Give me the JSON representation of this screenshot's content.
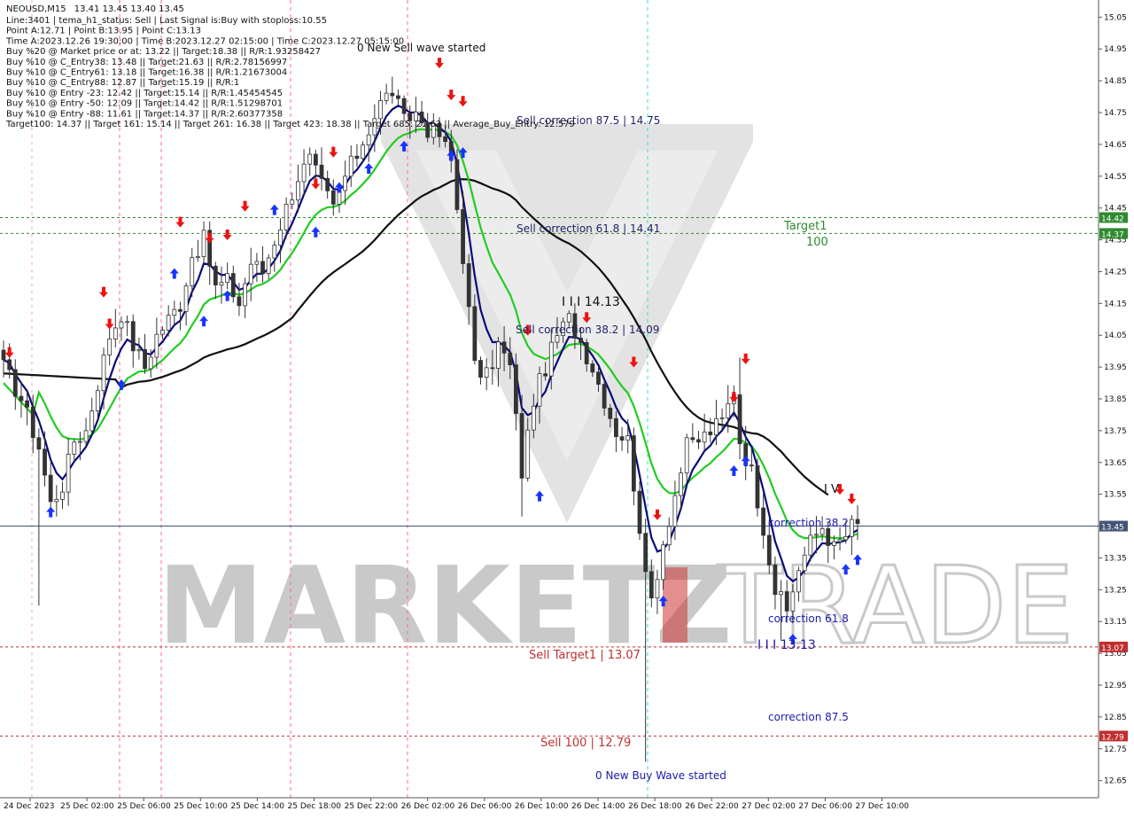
{
  "header": {
    "symbol": "NEOUSD,M15",
    "ohlc": "13.41 13.45 13.40 13.45",
    "lines": [
      "Line:3401 | tema_h1_status: Sell | Last Signal is:Buy with stoploss:10.55",
      "Point A:12.71 | Point B:13.95 | Point C:13.13",
      "Time A:2023.12.26 19:30:00 | Time B:2023.12.27 02:15:00 | Time C:2023.12.27 05:15:00",
      "Buy %20 @ Market price or at: 13.22 || Target:18.38 || R/R:1.93258427",
      "Buy %10 @ C_Entry38: 13.48 || Target:21.63 || R/R:2.78156997",
      "Buy %10 @ C_Entry61: 13.18 || Target:16.38 || R/R:1.21673004",
      "Buy %10 @ C_Entry88: 12.87 || Target:15.19 || R/R:1",
      "Buy %10 @ Entry -23: 12.42 || Target:15.14 || R/R:1.45454545",
      "Buy %10 @ Entry -50: 12.09 || Target:14.42 || R/R:1.51298701",
      "Buy %10 @ Entry -88: 11.61 || Target:14.37 || R/R:2.60377358",
      "Target100: 14.37 || Target 161: 15.14 || Target 261: 16.38 || Target 423: 18.38 || Target 685: 21.63 || Average_Buy_Entry: 12.579"
    ]
  },
  "colors": {
    "background": "#ffffff",
    "bull_candle": "#3a3a3a",
    "bear_candle": "#3a3a3a",
    "ma_fast": "#0a0a7a",
    "ma_mid": "#22cc22",
    "ma_slow": "#111111",
    "buy_arrow": "#1a33ff",
    "sell_arrow": "#ee1111",
    "target_green": "#2e8b2e",
    "sell_red": "#c03030",
    "watermark": "#c9c9c9",
    "watermark_accent": "#cc3333",
    "grid_pink": "#ff66aa",
    "cyan_line": "#33dddd",
    "blue_text": "#1a1aaa"
  },
  "annotations": {
    "new_sell_wave": "0 New Sell wave started",
    "sell_corr_875": "Sell correction 87.5 | 14.75",
    "sell_corr_618": "Sell correction 61.8 | 14.41",
    "sell_corr_382": "Sell correction 38.2 | 14.09",
    "wave_label_1413": "I I I 14.13",
    "target1": "Target1",
    "target1_value": "100",
    "sell_target1": "Sell Target1 | 13.07",
    "sell_100": "Sell 100 | 12.79",
    "new_buy_wave": "0 New Buy Wave started",
    "correction_382": "correction 38.2",
    "correction_618": "correction 61.8",
    "correction_875": "correction 87.5",
    "wave_label_1313": "I I I 13.13",
    "wave_label_iv": "I V"
  },
  "watermark": {
    "left": "MARKETZ",
    "right": "TRADE"
  },
  "chart_data": {
    "type": "candlestick",
    "ylim": [
      12.61,
      15.09
    ],
    "y_ticks": [
      "15.05",
      "14.95",
      "14.85",
      "14.75",
      "14.65",
      "14.55",
      "14.45",
      "14.35",
      "14.25",
      "14.15",
      "14.05",
      "13.95",
      "13.85",
      "13.75",
      "13.65",
      "13.55",
      "13.45",
      "13.35",
      "13.25",
      "13.15",
      "13.05",
      "12.95",
      "12.85",
      "12.75",
      "12.65"
    ],
    "x_ticks": [
      "24 Dec 2023",
      "25 Dec 02:00",
      "25 Dec 06:00",
      "25 Dec 10:00",
      "25 Dec 14:00",
      "25 Dec 18:00",
      "25 Dec 22:00",
      "26 Dec 02:00",
      "26 Dec 06:00",
      "26 Dec 10:00",
      "26 Dec 14:00",
      "26 Dec 18:00",
      "26 Dec 22:00",
      "27 Dec 02:00",
      "27 Dec 06:00",
      "27 Dec 10:00"
    ],
    "horizontal_levels": [
      {
        "value": 14.42,
        "label": "14.42",
        "color": "#2e8b2e",
        "style": "dashed"
      },
      {
        "value": 14.37,
        "label": "14.37",
        "color": "#2e8b2e",
        "style": "dashed"
      },
      {
        "value": 13.45,
        "label": "13.45",
        "color": "#445577",
        "style": "solid"
      },
      {
        "value": 13.07,
        "label": "13.07",
        "color": "#c03030",
        "style": "dashed"
      },
      {
        "value": 12.79,
        "label": "12.79",
        "color": "#c03030",
        "style": "dashed"
      }
    ],
    "current_price": 13.45,
    "close_path": [
      [
        0,
        13.95
      ],
      [
        3,
        13.85
      ],
      [
        6,
        13.7
      ],
      [
        8,
        13.52
      ],
      [
        10,
        13.58
      ],
      [
        12,
        13.72
      ],
      [
        14,
        13.75
      ],
      [
        16,
        13.9
      ],
      [
        18,
        14.05
      ],
      [
        20,
        14.12
      ],
      [
        22,
        14.02
      ],
      [
        24,
        13.95
      ],
      [
        26,
        14.05
      ],
      [
        28,
        14.1
      ],
      [
        30,
        14.15
      ],
      [
        32,
        14.3
      ],
      [
        34,
        14.35
      ],
      [
        36,
        14.2
      ],
      [
        38,
        14.22
      ],
      [
        40,
        14.15
      ],
      [
        42,
        14.28
      ],
      [
        44,
        14.25
      ],
      [
        46,
        14.35
      ],
      [
        48,
        14.45
      ],
      [
        50,
        14.55
      ],
      [
        52,
        14.6
      ],
      [
        54,
        14.52
      ],
      [
        56,
        14.45
      ],
      [
        58,
        14.55
      ],
      [
        60,
        14.62
      ],
      [
        62,
        14.7
      ],
      [
        64,
        14.78
      ],
      [
        66,
        14.82
      ],
      [
        68,
        14.72
      ],
      [
        70,
        14.75
      ],
      [
        72,
        14.7
      ],
      [
        74,
        14.68
      ],
      [
        76,
        14.6
      ],
      [
        78,
        14.3
      ],
      [
        80,
        13.95
      ],
      [
        82,
        13.92
      ],
      [
        84,
        14.02
      ],
      [
        86,
        13.95
      ],
      [
        88,
        13.62
      ],
      [
        90,
        13.85
      ],
      [
        92,
        13.95
      ],
      [
        94,
        14.05
      ],
      [
        96,
        14.1
      ],
      [
        98,
        14.03
      ],
      [
        100,
        13.95
      ],
      [
        102,
        13.85
      ],
      [
        104,
        13.75
      ],
      [
        106,
        13.72
      ],
      [
        108,
        13.45
      ],
      [
        109,
        13.28
      ],
      [
        110,
        13.22
      ],
      [
        112,
        13.4
      ],
      [
        114,
        13.55
      ],
      [
        116,
        13.7
      ],
      [
        118,
        13.72
      ],
      [
        120,
        13.75
      ],
      [
        122,
        13.78
      ],
      [
        124,
        13.88
      ],
      [
        125,
        13.72
      ],
      [
        127,
        13.62
      ],
      [
        129,
        13.45
      ],
      [
        131,
        13.25
      ],
      [
        133,
        13.18
      ],
      [
        135,
        13.32
      ],
      [
        137,
        13.4
      ],
      [
        139,
        13.45
      ],
      [
        141,
        13.38
      ],
      [
        143,
        13.42
      ],
      [
        144,
        13.45
      ]
    ],
    "special_wicks": [
      {
        "i": 109,
        "low": 12.71,
        "high": 13.35
      },
      {
        "i": 6,
        "low": 13.2,
        "high": 13.72
      },
      {
        "i": 125,
        "low": 13.66,
        "high": 13.98
      },
      {
        "i": 88,
        "low": 13.48,
        "high": 13.72
      },
      {
        "i": 132,
        "low": 13.09,
        "high": 13.28
      }
    ],
    "sell_signals": [
      {
        "i": 1,
        "price": 13.99
      },
      {
        "i": 17,
        "price": 14.18
      },
      {
        "i": 18,
        "price": 14.08
      },
      {
        "i": 30,
        "price": 14.4
      },
      {
        "i": 35,
        "price": 14.35
      },
      {
        "i": 38,
        "price": 14.36
      },
      {
        "i": 41,
        "price": 14.45
      },
      {
        "i": 53,
        "price": 14.52
      },
      {
        "i": 56,
        "price": 14.62
      },
      {
        "i": 74,
        "price": 14.9
      },
      {
        "i": 76,
        "price": 14.8
      },
      {
        "i": 78,
        "price": 14.78
      },
      {
        "i": 89,
        "price": 14.06
      },
      {
        "i": 99,
        "price": 14.1
      },
      {
        "i": 107,
        "price": 13.96
      },
      {
        "i": 111,
        "price": 13.48
      },
      {
        "i": 124,
        "price": 13.85
      },
      {
        "i": 126,
        "price": 13.97
      },
      {
        "i": 142,
        "price": 13.56
      },
      {
        "i": 144,
        "price": 13.53
      }
    ],
    "buy_signals": [
      {
        "i": 8,
        "price": 13.5
      },
      {
        "i": 20,
        "price": 13.9
      },
      {
        "i": 29,
        "price": 14.25
      },
      {
        "i": 34,
        "price": 14.1
      },
      {
        "i": 38,
        "price": 14.18
      },
      {
        "i": 46,
        "price": 14.45
      },
      {
        "i": 53,
        "price": 14.38
      },
      {
        "i": 57,
        "price": 14.52
      },
      {
        "i": 62,
        "price": 14.58
      },
      {
        "i": 68,
        "price": 14.65
      },
      {
        "i": 76,
        "price": 14.62
      },
      {
        "i": 78,
        "price": 14.63
      },
      {
        "i": 91,
        "price": 13.55
      },
      {
        "i": 112,
        "price": 13.22
      },
      {
        "i": 124,
        "price": 13.63
      },
      {
        "i": 126,
        "price": 13.66
      },
      {
        "i": 134,
        "price": 13.1
      },
      {
        "i": 143,
        "price": 13.32
      },
      {
        "i": 145,
        "price": 13.35
      }
    ]
  }
}
